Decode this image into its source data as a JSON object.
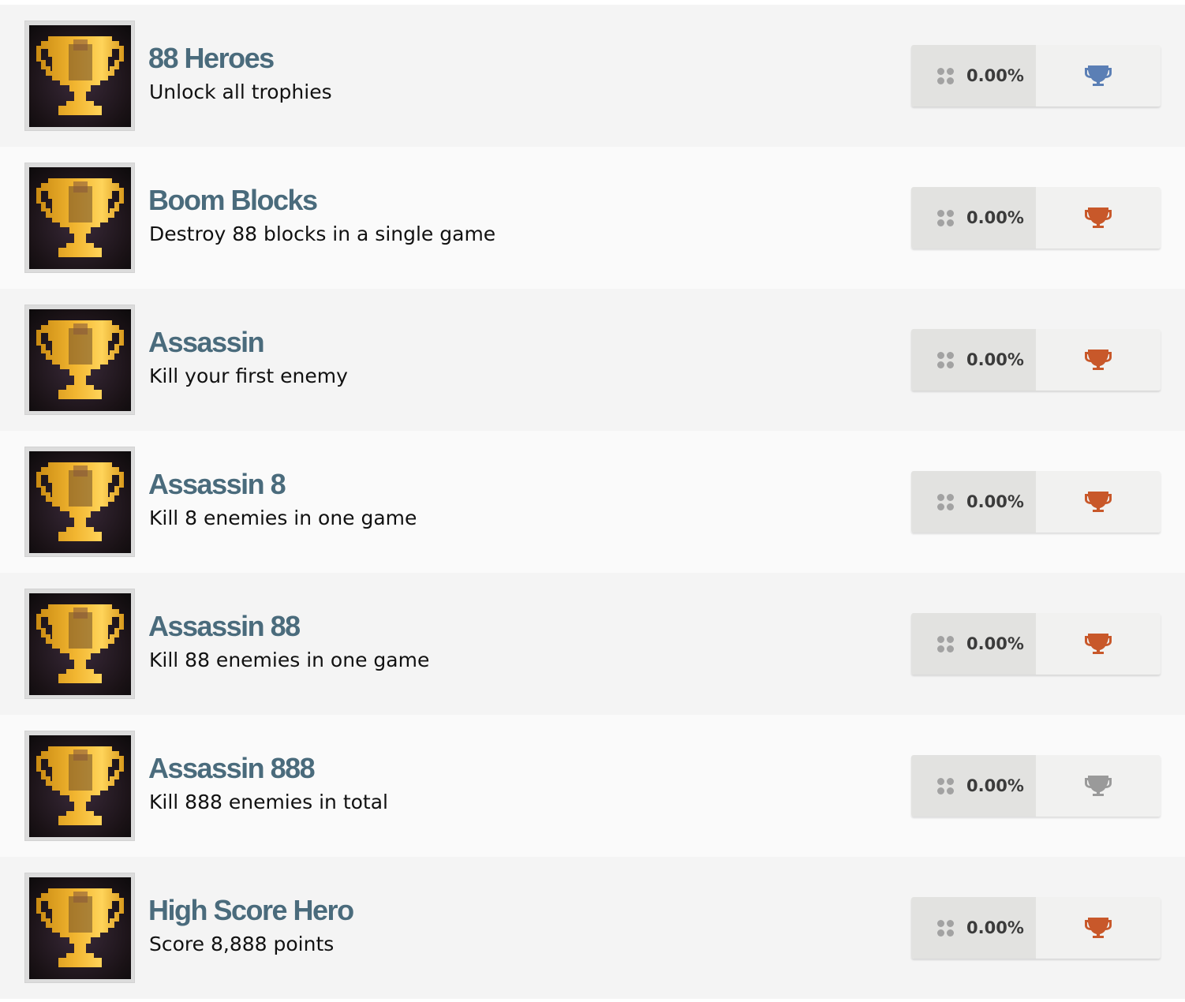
{
  "trophies": [
    {
      "title": "88 Heroes",
      "description": "Unlock all trophies",
      "rarity": "0.00%",
      "grade": "platinum",
      "grade_color": "#5b7fb5"
    },
    {
      "title": "Boom Blocks",
      "description": "Destroy 88 blocks in a single game",
      "rarity": "0.00%",
      "grade": "bronze",
      "grade_color": "#c8582a"
    },
    {
      "title": "Assassin",
      "description": "Kill your first enemy",
      "rarity": "0.00%",
      "grade": "bronze",
      "grade_color": "#c8582a"
    },
    {
      "title": "Assassin 8",
      "description": "Kill 8 enemies in one game",
      "rarity": "0.00%",
      "grade": "bronze",
      "grade_color": "#c8582a"
    },
    {
      "title": "Assassin 88",
      "description": "Kill 88 enemies in one game",
      "rarity": "0.00%",
      "grade": "bronze",
      "grade_color": "#c8582a"
    },
    {
      "title": "Assassin 888",
      "description": "Kill 888 enemies in total",
      "rarity": "0.00%",
      "grade": "silver",
      "grade_color": "#9a9a9a"
    },
    {
      "title": "High Score Hero",
      "description": "Score 8,888 points",
      "rarity": "0.00%",
      "grade": "bronze",
      "grade_color": "#c8582a"
    }
  ],
  "icons": {
    "rarity": "rarity-dots-icon",
    "grade": "trophy-icon",
    "thumbnail": "gold-cup-icon"
  },
  "colors": {
    "title": "#4a6b7c",
    "cup_gold": "#f2b631",
    "row_odd": "#f4f4f4",
    "row_even": "#fafafa"
  }
}
